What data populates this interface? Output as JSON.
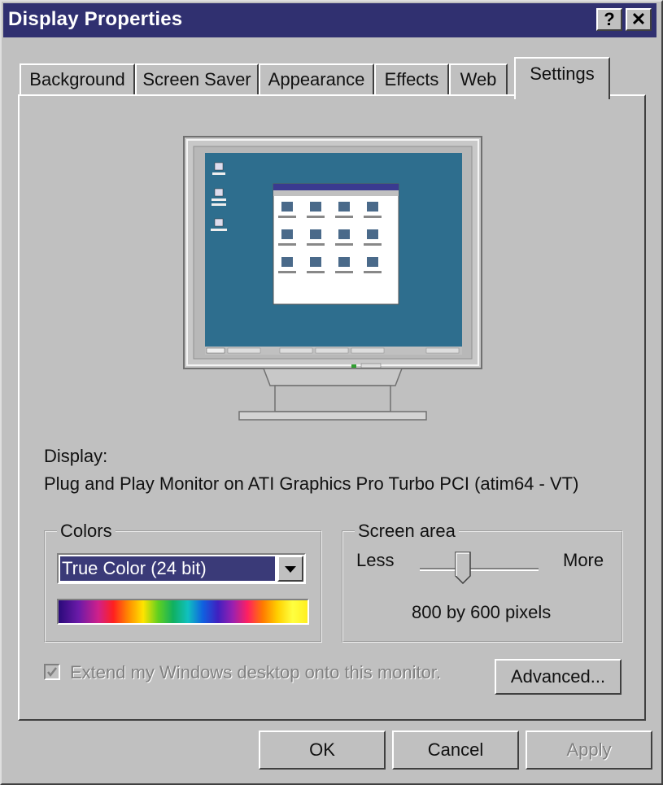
{
  "window": {
    "title": "Display Properties",
    "help_label": "?",
    "close_label": "✕"
  },
  "tabs": [
    {
      "label": "Background"
    },
    {
      "label": "Screen Saver"
    },
    {
      "label": "Appearance"
    },
    {
      "label": "Effects"
    },
    {
      "label": "Web"
    },
    {
      "label": "Settings",
      "active": true
    }
  ],
  "display": {
    "label": "Display:",
    "value": "Plug and Play Monitor on ATI Graphics Pro Turbo PCI (atim64 - VT)"
  },
  "colors": {
    "legend": "Colors",
    "selected": "True Color (24 bit)",
    "spectrum_icon": "color-spectrum-bar"
  },
  "screen_area": {
    "legend": "Screen area",
    "less_label": "Less",
    "more_label": "More",
    "value_text": "800 by 600 pixels",
    "slider_position": 0.36
  },
  "extend_checkbox": {
    "label": "Extend my Windows desktop onto this monitor.",
    "checked": true,
    "enabled": false
  },
  "buttons": {
    "advanced": "Advanced...",
    "ok": "OK",
    "cancel": "Cancel",
    "apply": "Apply"
  },
  "colors_theme": {
    "title_bar": "#303070",
    "desktop_preview": "#2e6e8e",
    "face": "#c0c0c0",
    "selection": "#3a3a78"
  }
}
